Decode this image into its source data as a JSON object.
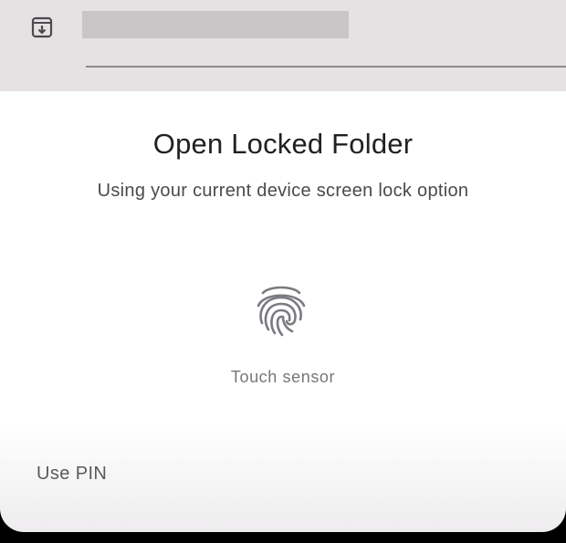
{
  "background_app": {
    "icon": "archive-download-icon"
  },
  "dialog": {
    "title": "Open Locked Folder",
    "subtitle": "Using your current device screen lock option",
    "sensor_icon": "fingerprint-icon",
    "sensor_label": "Touch sensor",
    "use_pin_label": "Use PIN"
  },
  "colors": {
    "sheet_background": "#ffffff",
    "background_app": "#e6e2e4",
    "title_text": "#202124",
    "secondary_text": "#76767b",
    "fingerprint_stroke": "#7a7a80"
  }
}
